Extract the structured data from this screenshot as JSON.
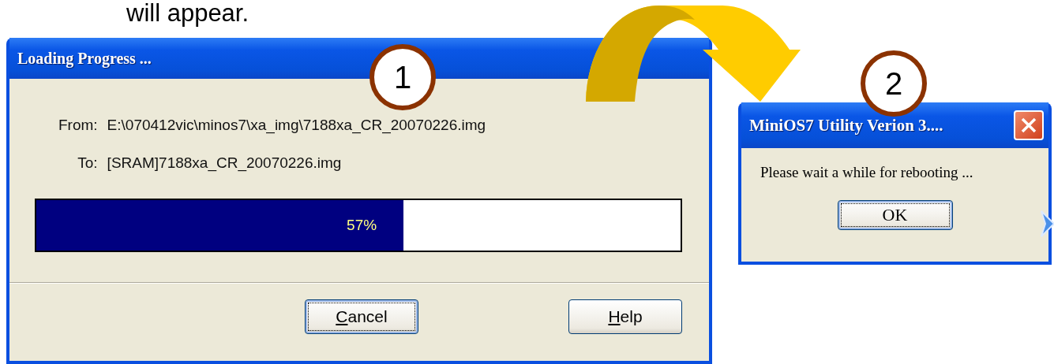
{
  "caption": "will appear.",
  "progress_dialog": {
    "title": "Loading Progress ...",
    "fields": [
      {
        "label": "From:",
        "value": "E:\\070412vic\\minos7\\xa_img\\7188xa_CR_20070226.img"
      },
      {
        "label": "To:",
        "value": "[SRAM]7188xa_CR_20070226.img"
      }
    ],
    "progress": {
      "level": 0.57,
      "reading": "57%"
    },
    "buttons": [
      {
        "label": "Cancel",
        "focused": true
      },
      {
        "label": "Help",
        "focused": false
      }
    ]
  },
  "reboot_dialog": {
    "title": "MiniOS7 Utility Verion 3....",
    "message": "Please wait a while for rebooting ...",
    "buttons": [
      {
        "label": "OK",
        "focused": true
      }
    ]
  },
  "callouts": [
    {
      "number": "1"
    },
    {
      "number": "2"
    }
  ]
}
